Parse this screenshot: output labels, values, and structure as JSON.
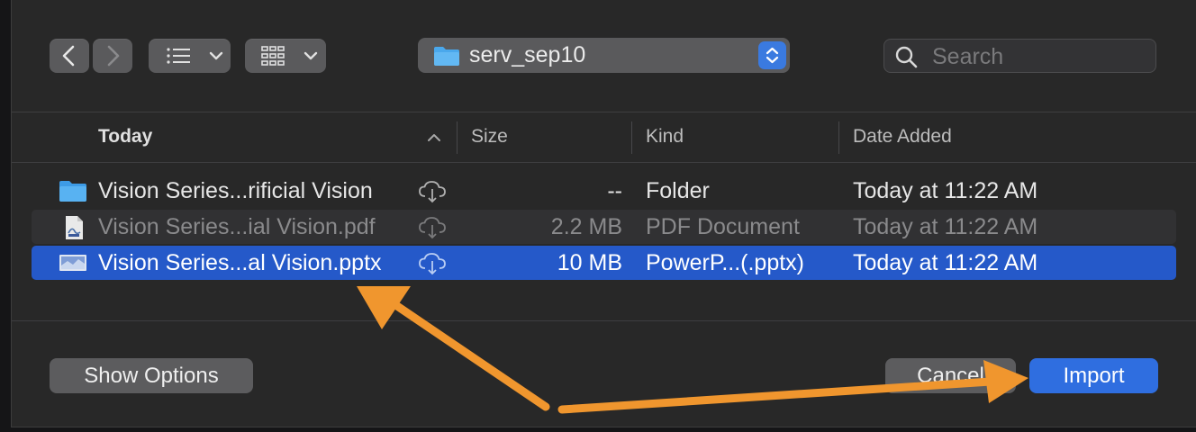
{
  "toolbar": {
    "back_icon": "chevron-left-icon",
    "forward_icon": "chevron-right-icon",
    "view_list_icon": "list-view-icon",
    "view_grid_icon": "grid-view-icon",
    "location": "serv_sep10",
    "search_placeholder": "Search"
  },
  "columns": {
    "name": "Today",
    "size": "Size",
    "kind": "Kind",
    "date": "Date Added"
  },
  "files": [
    {
      "name": "Vision Series...rificial Vision",
      "size": "--",
      "kind": "Folder",
      "date": "Today at 11:22 AM",
      "icon": "folder-icon",
      "state": "normal"
    },
    {
      "name": "Vision Series...ial Vision.pdf",
      "size": "2.2 MB",
      "kind": "PDF Document",
      "date": "Today at 11:22 AM",
      "icon": "pdf-file-icon",
      "state": "dimmed"
    },
    {
      "name": "Vision Series...al Vision.pptx",
      "size": "10 MB",
      "kind": "PowerP...(.pptx)",
      "date": "Today at 11:22 AM",
      "icon": "pptx-file-icon",
      "state": "selected"
    }
  ],
  "footer": {
    "show_options": "Show Options",
    "cancel": "Cancel",
    "import": "Import"
  },
  "colors": {
    "accent": "#2f6ee0",
    "selection": "#2559c9",
    "annotation_arrow": "#f0962e"
  }
}
